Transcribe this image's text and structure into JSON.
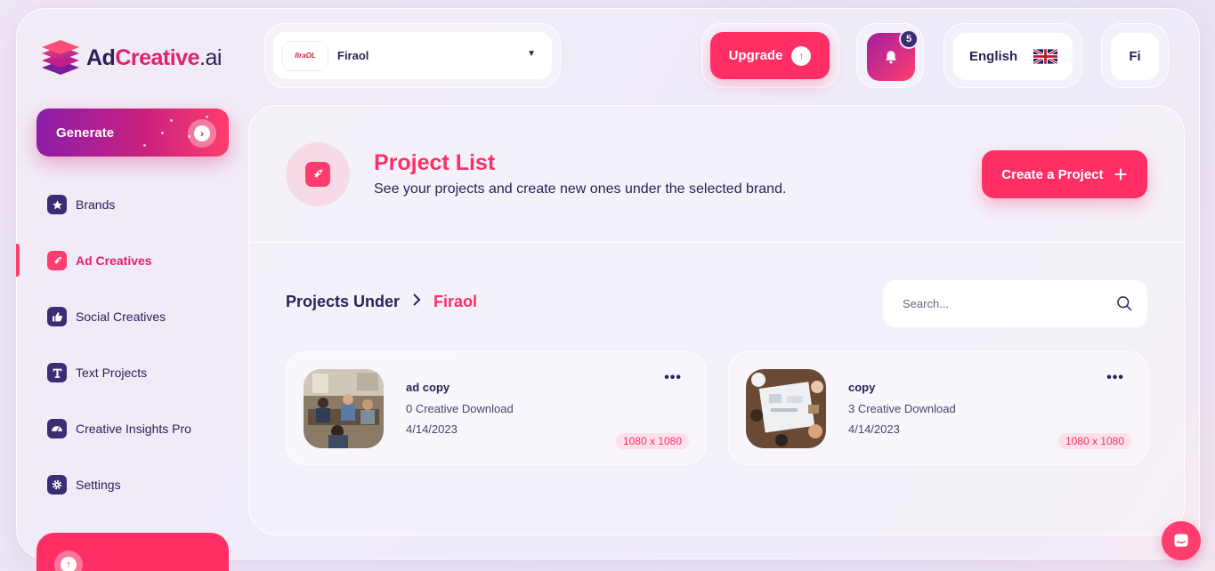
{
  "brand": {
    "logo_ad": "Ad",
    "logo_creative": "Creative",
    "logo_ai": ".ai"
  },
  "sidebar": {
    "generate_label": "Generate",
    "items": [
      {
        "label": "Brands",
        "icon": "star-icon"
      },
      {
        "label": "Ad Creatives",
        "icon": "rocket-icon",
        "active": true
      },
      {
        "label": "Social Creatives",
        "icon": "thumbs-up-icon"
      },
      {
        "label": "Text Projects",
        "icon": "text-t-icon"
      },
      {
        "label": "Creative Insights Pro",
        "icon": "gauge-icon"
      },
      {
        "label": "Settings",
        "icon": "gear-icon"
      }
    ]
  },
  "topbar": {
    "selected_brand": "Firaol",
    "brand_logo_text": "firaOL",
    "upgrade_label": "Upgrade",
    "notification_count": "5",
    "language": "English",
    "avatar_initials": "Fi"
  },
  "header": {
    "title": "Project List",
    "subtitle": "See your projects and create new ones under the selected brand.",
    "create_label": "Create a Project"
  },
  "breadcrumb": {
    "root": "Projects Under",
    "current": "Firaol"
  },
  "search": {
    "placeholder": "Search..."
  },
  "projects": [
    {
      "title": "ad copy",
      "downloads": "0 Creative Download",
      "date": "4/14/2023",
      "size": "1080 x 1080"
    },
    {
      "title": "copy",
      "downloads": "3 Creative Download",
      "date": "4/14/2023",
      "size": "1080 x 1080"
    }
  ],
  "colors": {
    "accent": "#ff2f66",
    "navy": "#2b2257",
    "icon_bg": "#3a2d74"
  }
}
